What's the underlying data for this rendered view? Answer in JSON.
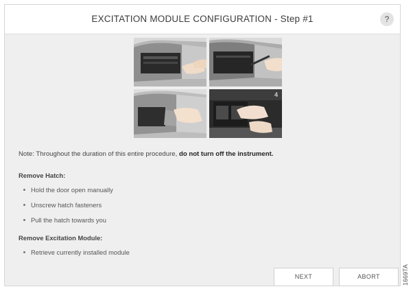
{
  "dialog": {
    "title": "EXCITATION MODULE CONFIGURATION - Step #1",
    "help_label": "?"
  },
  "photos": {
    "step4_number": "4"
  },
  "note": {
    "prefix": "Note: Throughout the duration of this entire procedure, ",
    "emphasis": "do not turn off the instrument."
  },
  "sections": [
    {
      "heading": "Remove Hatch:",
      "items": [
        "Hold the door open manually",
        "Unscrew hatch fasteners",
        "Pull the hatch towards you"
      ]
    },
    {
      "heading": "Remove Excitation Module:",
      "items": [
        "Retrieve currently installed module"
      ]
    }
  ],
  "buttons": {
    "next": "NEXT",
    "abort": "ABORT"
  },
  "figure_code": "1669TA"
}
